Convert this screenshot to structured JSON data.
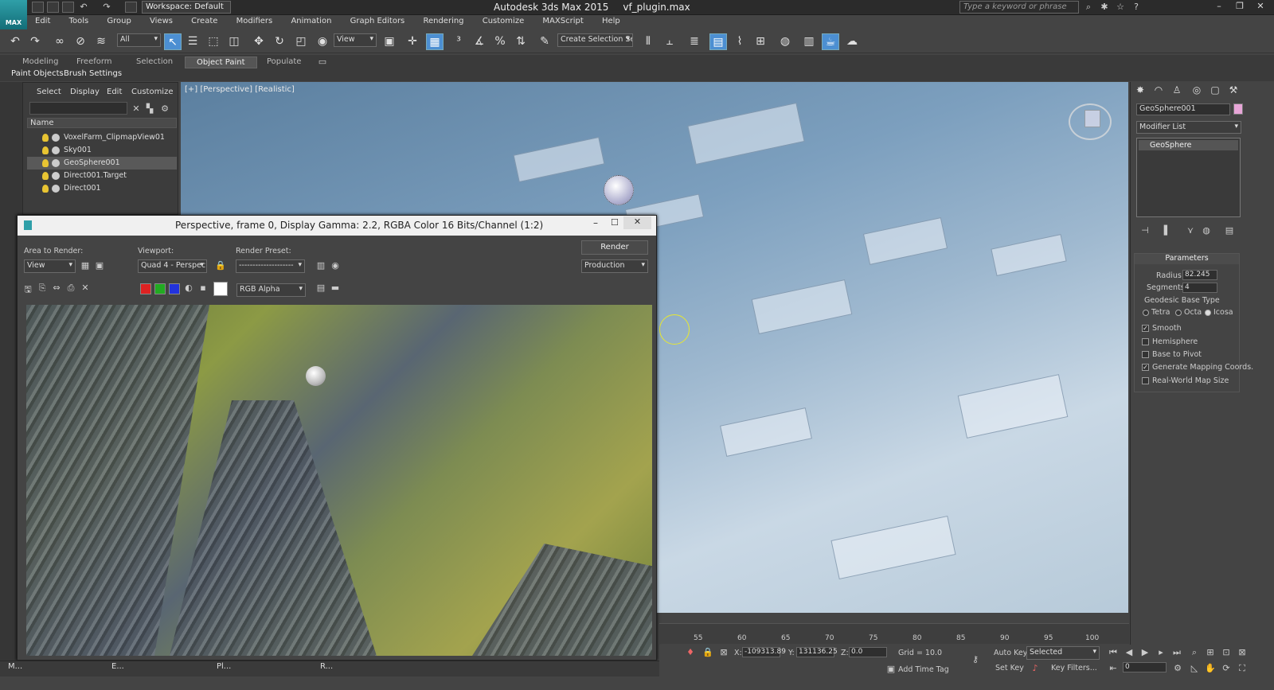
{
  "app": {
    "title": "Autodesk 3ds Max  2015",
    "file": "vf_plugin.max",
    "logo_text": "MAX",
    "workspace": "Workspace: Default",
    "search_placeholder": "Type a keyword or phrase"
  },
  "menu": [
    "Edit",
    "Tools",
    "Group",
    "Views",
    "Create",
    "Modifiers",
    "Animation",
    "Graph Editors",
    "Rendering",
    "Customize",
    "MAXScript",
    "Help"
  ],
  "toolbar": {
    "selection_filter": "All",
    "ref_coord": "View",
    "named_selection": "Create Selection Se"
  },
  "ribbon": {
    "tabs": [
      "Modeling",
      "Freeform",
      "Selection",
      "Object Paint",
      "Populate"
    ],
    "active_tab": "Object Paint",
    "sub": [
      "Paint Objects",
      "Brush Settings"
    ]
  },
  "scene_explorer": {
    "tabs": [
      "Select",
      "Display",
      "Edit",
      "Customize"
    ],
    "column": "Name",
    "items": [
      {
        "name": "VoxelFarm_ClipmapView01",
        "selected": false
      },
      {
        "name": "Sky001",
        "selected": false
      },
      {
        "name": "GeoSphere001",
        "selected": true
      },
      {
        "name": "Direct001.Target",
        "selected": false
      },
      {
        "name": "Direct001",
        "selected": false
      }
    ]
  },
  "viewport": {
    "label": "[+] [Perspective] [Realistic]"
  },
  "render_window": {
    "title": "Perspective, frame 0, Display Gamma: 2.2, RGBA Color 16 Bits/Channel (1:2)",
    "area_label": "Area to Render:",
    "area_value": "View",
    "viewport_label": "Viewport:",
    "viewport_value": "Quad 4 - Perspec",
    "preset_label": "Render Preset:",
    "preset_value": "--------------------",
    "render_button": "Render",
    "render_mode": "Production",
    "channel": "RGB Alpha"
  },
  "command_panel": {
    "object_name": "GeoSphere001",
    "object_color": "#e8a6d8",
    "modifier_list": "Modifier List",
    "stack": [
      "GeoSphere"
    ],
    "params_title": "Parameters",
    "radius_label": "Radius:",
    "radius": "82.245",
    "segments_label": "Segments:",
    "segments": "4",
    "base_type_label": "Geodesic Base Type",
    "base_types": [
      {
        "label": "Tetra",
        "on": false
      },
      {
        "label": "Octa",
        "on": false
      },
      {
        "label": "Icosa",
        "on": true
      }
    ],
    "checks": [
      {
        "label": "Smooth",
        "on": true
      },
      {
        "label": "Hemisphere",
        "on": false
      },
      {
        "label": "Base to Pivot",
        "on": false
      },
      {
        "label": "Generate Mapping Coords.",
        "on": true
      },
      {
        "label": "Real-World Map Size",
        "on": false
      }
    ]
  },
  "timeline": {
    "ticks": [
      "55",
      "60",
      "65",
      "70",
      "75",
      "80",
      "85",
      "90",
      "95",
      "100"
    ]
  },
  "status": {
    "x_label": "X:",
    "x": "-109313.89",
    "y_label": "Y:",
    "y": "131136.25",
    "z_label": "Z:",
    "z": "0.0",
    "grid": "Grid = 10.0",
    "auto_key": "Auto Key",
    "set_key": "Set Key",
    "selected": "Selected",
    "key_filters": "Key Filters...",
    "add_time_tag": "Add Time Tag",
    "frame": "0"
  },
  "taskbar": [
    "M...",
    "E...",
    "Pl...",
    "R..."
  ]
}
